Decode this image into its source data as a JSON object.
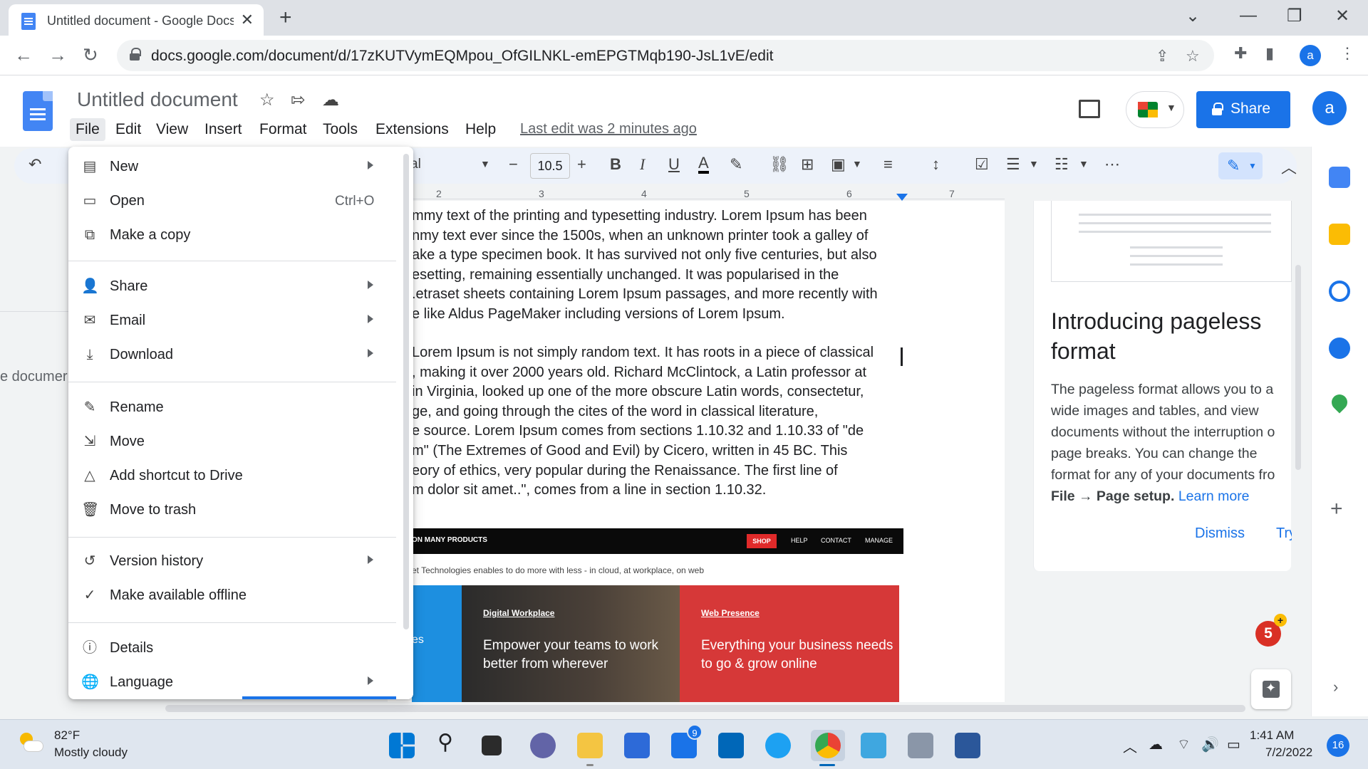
{
  "browser": {
    "tab_title": "Untitled document - Google Docs",
    "url": "docs.google.com/document/d/17zKUTVymEQMpou_OfGILNKL-emEPGTMqb190-JsL1vE/edit",
    "profile_initial": "a"
  },
  "docs": {
    "title": "Untitled document",
    "menus": [
      "File",
      "Edit",
      "View",
      "Insert",
      "Format",
      "Tools",
      "Extensions",
      "Help"
    ],
    "last_edit": "Last edit was 2 minutes ago",
    "share_label": "Share",
    "account_initial": "a"
  },
  "toolbar": {
    "font_name": "al",
    "font_size": "10.5"
  },
  "ruler": {
    "ticks": [
      "2",
      "3",
      "4",
      "5",
      "6",
      "7"
    ]
  },
  "outline_hint": "e documer",
  "document": {
    "para1": [
      "mmy text of the printing and typesetting industry. Lorem Ipsum has been",
      "nmy text ever since the 1500s, when an unknown printer took a galley of",
      "ake a type specimen book. It has survived not only five centuries, but also",
      "esetting, remaining essentially unchanged. It was popularised in the",
      ".etraset sheets containing Lorem Ipsum passages, and more recently with",
      "e like Aldus PageMaker including versions of Lorem Ipsum."
    ],
    "para2": [
      "Lorem Ipsum is not simply random text. It has roots in a piece of classical",
      ", making it over 2000 years old. Richard McClintock, a Latin professor at",
      "in Virginia, looked up one of the more obscure Latin words, consectetur,",
      "ge, and going through the cites of the word in classical literature,",
      "e source. Lorem Ipsum comes from sections 1.10.32 and 1.10.33 of \"de",
      "m\" (The Extremes of Good and Evil) by Cicero, written in 45 BC. This",
      "eory of ethics, very popular during the Renaissance. The first line of",
      "m dolor sit amet..\", comes from a line in section 1.10.32."
    ],
    "embed": {
      "bar_text": "ON MANY PRODUCTS",
      "nav": [
        "SHOP",
        "HELP",
        "CONTACT",
        "MANAGE"
      ],
      "subtitle": "et Technologies enables to do more with less - in cloud, at workplace, on web",
      "panel1_text": "es",
      "panel2_tag": "Digital Workplace",
      "panel2_text": "Empower your teams to work better from wherever",
      "panel3_tag": "Web Presence",
      "panel3_text": "Everything your business needs to go & grow online"
    }
  },
  "side_panel": {
    "title": "Introducing pageless format",
    "body_lines": [
      "The pageless format allows you to a",
      "wide images and tables, and view",
      "documents without the interruption o",
      "page breaks. You can change the",
      "format for any of your documents fro"
    ],
    "body_bold": "File → Page setup.",
    "learn_more": "Learn more",
    "dismiss": "Dismiss",
    "try": "Try it"
  },
  "notification_count": "5",
  "file_menu": {
    "items": [
      {
        "label": "New",
        "icon": "doc-icon",
        "submenu": true
      },
      {
        "label": "Open",
        "icon": "folder-icon",
        "shortcut": "Ctrl+O"
      },
      {
        "label": "Make a copy",
        "icon": "copy-icon"
      },
      {
        "label": "Share",
        "icon": "person-add-icon",
        "submenu": true
      },
      {
        "label": "Email",
        "icon": "mail-icon",
        "submenu": true
      },
      {
        "label": "Download",
        "icon": "download-icon",
        "submenu": true
      },
      {
        "label": "Rename",
        "icon": "rename-icon"
      },
      {
        "label": "Move",
        "icon": "move-icon"
      },
      {
        "label": "Add shortcut to Drive",
        "icon": "drive-shortcut-icon"
      },
      {
        "label": "Move to trash",
        "icon": "trash-icon"
      },
      {
        "label": "Version history",
        "icon": "history-icon",
        "submenu": true
      },
      {
        "label": "Make available offline",
        "icon": "offline-icon"
      },
      {
        "label": "Details",
        "icon": "info-icon"
      },
      {
        "label": "Language",
        "icon": "globe-icon",
        "submenu": true
      }
    ]
  },
  "taskbar": {
    "temperature": "82°F",
    "condition": "Mostly cloudy",
    "mail_badge": "9",
    "time": "1:41 AM",
    "date": "7/2/2022",
    "notifications": "16"
  }
}
